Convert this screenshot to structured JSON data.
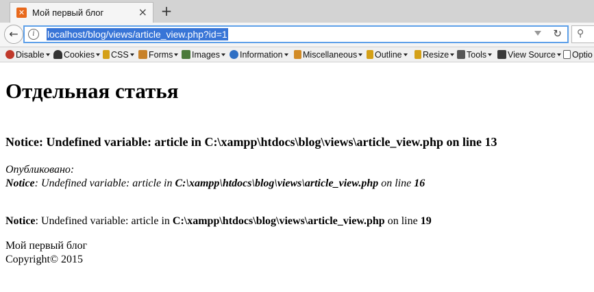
{
  "browser": {
    "tab": {
      "title": "Мой первый блог",
      "close_glyph": "×"
    },
    "new_tab_glyph": "+",
    "url": "localhost/blog/views/article_view.php?id=1",
    "reload_glyph": "↻",
    "back_glyph": "←",
    "search_glyph": "⚲"
  },
  "toolbar": {
    "items": [
      {
        "label": "Disable",
        "icon": "disable-icon",
        "color": "#c0392b"
      },
      {
        "label": "Cookies",
        "icon": "cookies-icon",
        "color": "#333333"
      },
      {
        "label": "CSS",
        "icon": "css-icon",
        "color": "#d4a017"
      },
      {
        "label": "Forms",
        "icon": "forms-icon",
        "color": "#c8822a"
      },
      {
        "label": "Images",
        "icon": "images-icon",
        "color": "#4a7a3a"
      },
      {
        "label": "Information",
        "icon": "information-icon",
        "color": "#2f6fc4"
      },
      {
        "label": "Miscellaneous",
        "icon": "miscellaneous-icon",
        "color": "#d28b26"
      },
      {
        "label": "Outline",
        "icon": "outline-icon",
        "color": "#d4a017"
      },
      {
        "label": "Resize",
        "icon": "resize-icon",
        "color": "#d4a017"
      },
      {
        "label": "Tools",
        "icon": "tools-icon",
        "color": "#555555"
      },
      {
        "label": "View Source",
        "icon": "view-source-icon",
        "color": "#3a3a3a"
      },
      {
        "label": "Optio",
        "icon": "options-icon",
        "color": "#555555"
      }
    ]
  },
  "page": {
    "heading": "Отдельная статья",
    "notice_title": {
      "prefix": "Notice: Undefined variable: article in C:\\xampp\\htdocs\\blog\\views\\article_view.php on line 13"
    },
    "published_label": "Опубликовано:",
    "notice_italic": {
      "word": "Notice",
      "text1": ": Undefined variable: article in ",
      "path": "C:\\xampp\\htdocs\\blog\\views\\article_view.php",
      "text2": " on line ",
      "line": "16"
    },
    "notice_plain": {
      "word": "Notice",
      "text1": ": Undefined variable: article in ",
      "path": "C:\\xampp\\htdocs\\blog\\views\\article_view.php",
      "text2": " on line ",
      "line": "19"
    },
    "footer": {
      "blog_name": "Мой первый блог",
      "copyright": "Copyright© 2015"
    }
  }
}
